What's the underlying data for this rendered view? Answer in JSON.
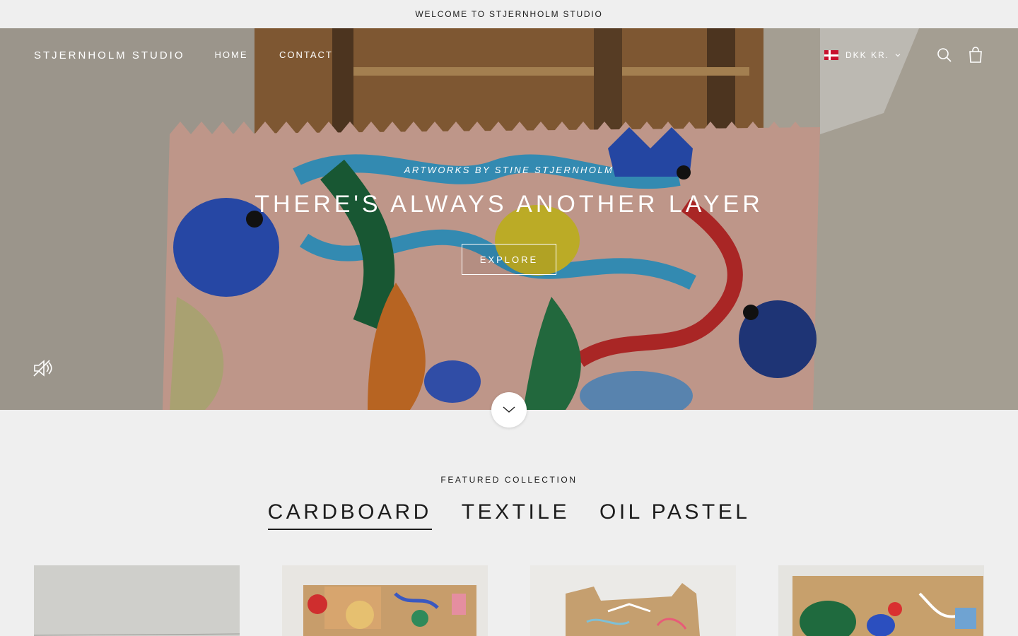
{
  "announcement": {
    "text": "WELCOME TO STJERNHOLM STUDIO"
  },
  "header": {
    "logo": "STJERNHOLM STUDIO",
    "nav": [
      {
        "label": "HOME"
      },
      {
        "label": "CONTACT"
      }
    ],
    "currency": {
      "label": "DKK KR.",
      "flag_icon": "denmark-flag-icon"
    },
    "icons": [
      "search-icon",
      "cart-icon"
    ]
  },
  "hero": {
    "subheading": "ARTWORKS BY STINE STJERNHOLM",
    "title": "THERE'S ALWAYS ANOTHER LAYER",
    "button": "EXPLORE",
    "mute_icon": "speaker-muted-icon",
    "scroll_icon": "chevron-down-icon"
  },
  "featured": {
    "label": "FEATURED COLLECTION",
    "tabs": [
      {
        "label": "CARDBOARD",
        "active": true
      },
      {
        "label": "TEXTILE",
        "active": false
      },
      {
        "label": "OIL PASTEL",
        "active": false
      }
    ]
  },
  "colors": {
    "page_bg": "#efefef",
    "text": "#1c1c1c",
    "overlay_text": "#ffffff"
  }
}
